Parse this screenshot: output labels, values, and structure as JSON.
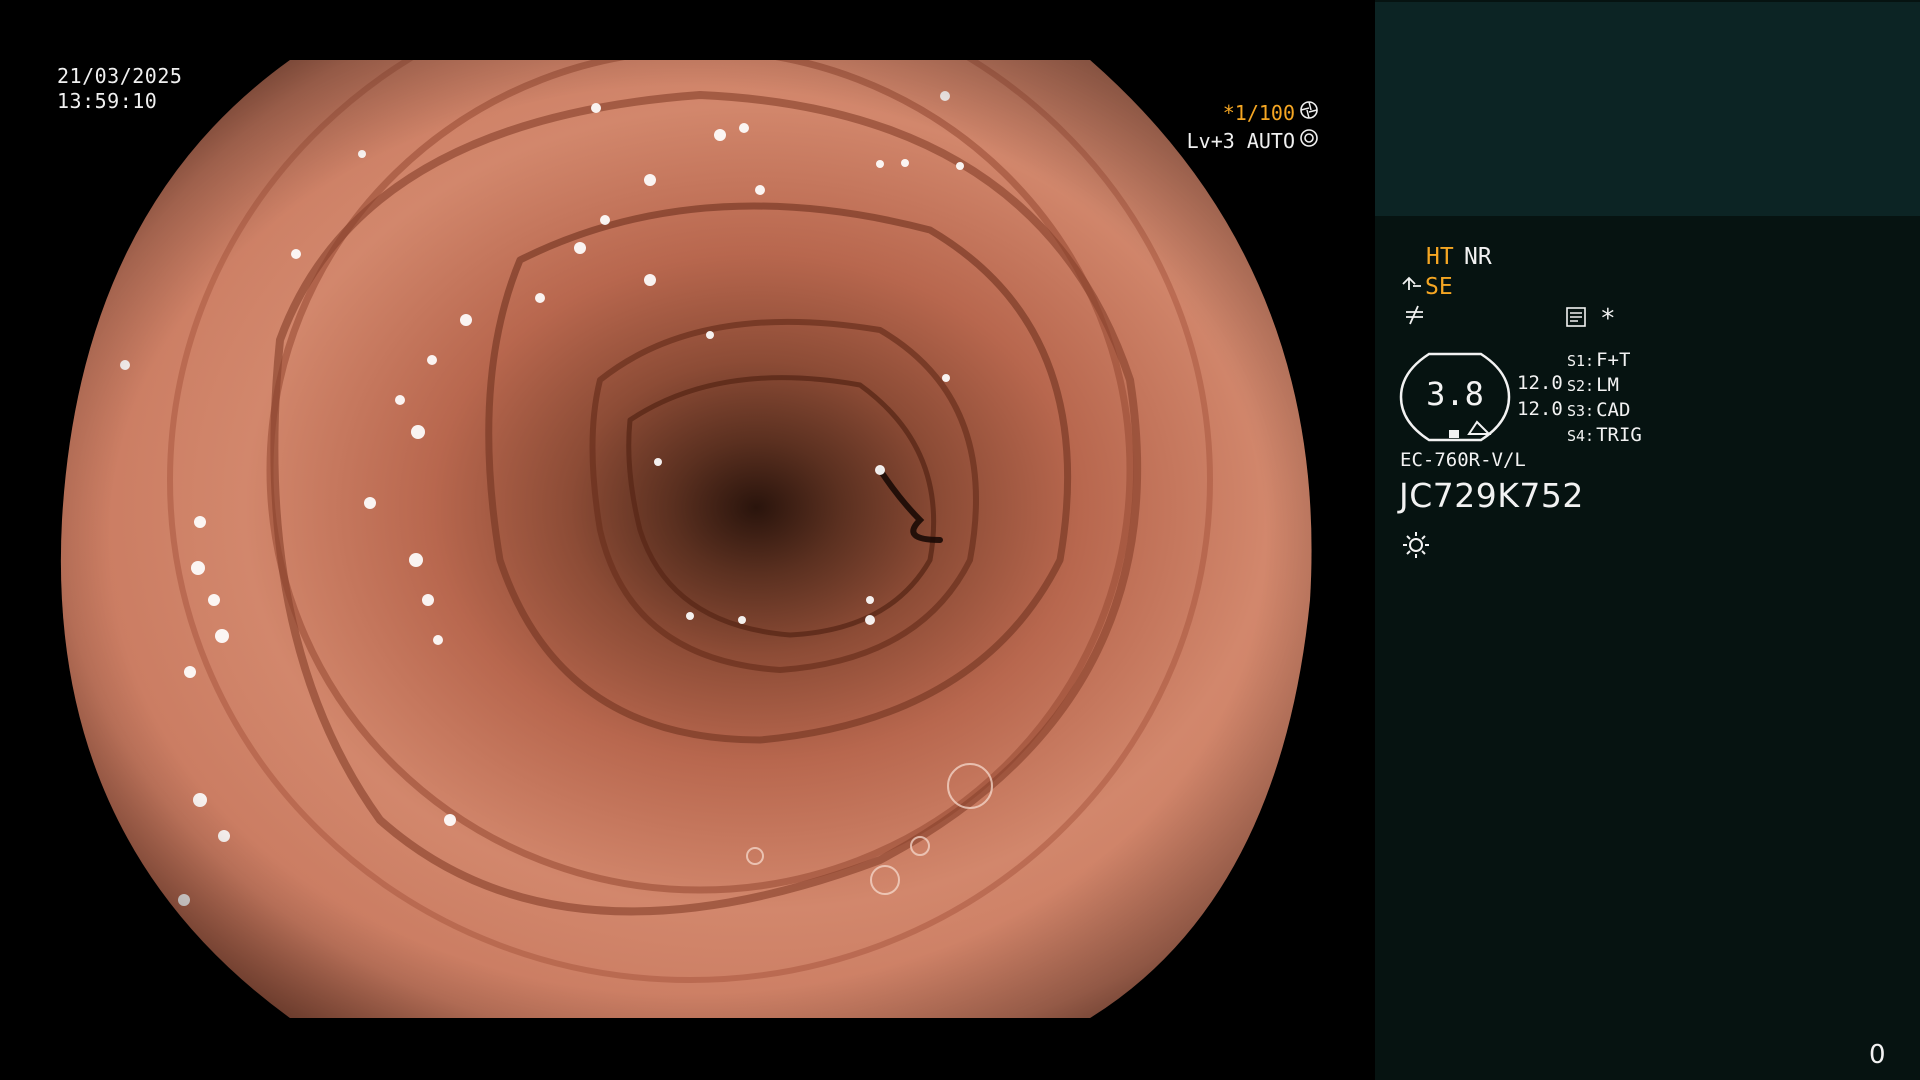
{
  "video": {
    "date": "21/03/2025",
    "time": "13:59:10",
    "shutter_speed": "*1/100",
    "shutter_icon": "shutter-icon",
    "iris_mode": "Lv+3 AUTO",
    "iris_icon": "iris-icon"
  },
  "panel": {
    "enhancement_mode": "HT",
    "noise_reduction": "NR",
    "structure_enhancement": "SE",
    "se_icon": "structure-enhancement-icon",
    "enhance_icon": "enhancement-icon",
    "record_icon": "record-icon",
    "marker": "*",
    "zoom_value": "3.8",
    "ratios": [
      "12.0",
      "12.0"
    ],
    "switches": [
      {
        "key": "S1:",
        "label": "F+T"
      },
      {
        "key": "S2:",
        "label": "LM"
      },
      {
        "key": "S3:",
        "label": "CAD"
      },
      {
        "key": "S4:",
        "label": "TRIG"
      }
    ],
    "scope_model": "EC-760R-V/L",
    "serial_number": "JC729K752",
    "light_icon": "light-source-icon",
    "frame_counter": "0"
  },
  "colors": {
    "accent_orange": "#f5a623",
    "panel_background": "#061311",
    "panel_top_box": "#0c2424",
    "mucosa": "#c97a60"
  }
}
